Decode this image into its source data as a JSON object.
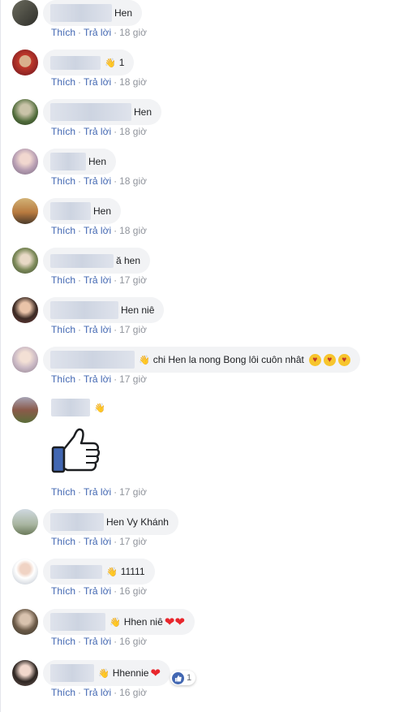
{
  "labels": {
    "like": "Thích",
    "reply": "Trả lời",
    "sep": "·"
  },
  "comments": [
    {
      "text": "Hen",
      "wave": "",
      "time": "18 giờ"
    },
    {
      "text": "1",
      "wave": "👋",
      "time": "18 giờ"
    },
    {
      "text": "Hen",
      "wave": "",
      "time": "18 giờ"
    },
    {
      "text": "Hen",
      "wave": "",
      "time": "18 giờ"
    },
    {
      "text": "Hen",
      "wave": "",
      "time": "18 giờ"
    },
    {
      "text": "ă hen",
      "wave": "",
      "time": "17 giờ"
    },
    {
      "text": "Hen niê",
      "wave": "",
      "time": "17 giờ"
    },
    {
      "text": "chi Hen la nong Bong lôi cuôn nhât",
      "wave": "👋",
      "time": "17 giờ"
    },
    {
      "text": "",
      "wave": "👋",
      "time": "17 giờ",
      "sticker": "thumbs-up"
    },
    {
      "text": "Hen Vy Khánh",
      "wave": "",
      "time": "17 giờ"
    },
    {
      "text": "11111",
      "wave": "👋",
      "time": "16 giờ"
    },
    {
      "text": "Hhen niê",
      "wave": "👋",
      "time": "16 giờ"
    },
    {
      "text": "Hhennie",
      "wave": "👋",
      "time": "16 giờ",
      "reaction_count": "1"
    }
  ],
  "colors": {
    "link": "#4267b2",
    "bubble": "#f2f3f5",
    "heart": "#e8262c",
    "meta": "#90949c"
  }
}
